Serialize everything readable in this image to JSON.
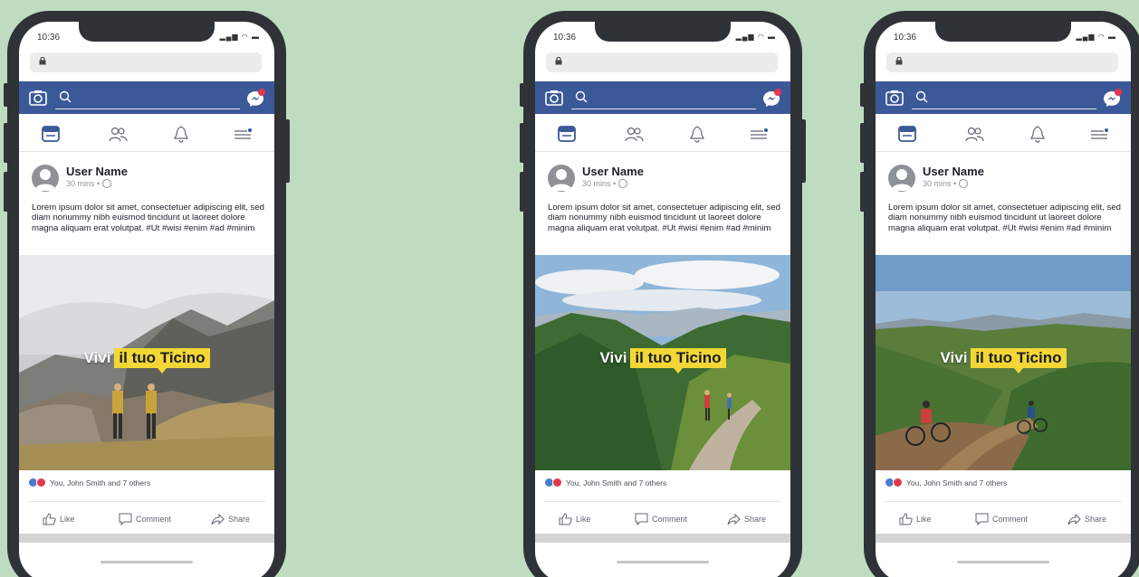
{
  "phones": [
    {
      "status": {
        "time": "10:36"
      },
      "post": {
        "user_name": "User Name",
        "meta": "30 mins •",
        "text": "Lorem ipsum dolor sit amet, consectetuer adipiscing elit, sed diam nonummy nibh euismod tincidunt ut laoreet dolore magna aliquam erat volutpat. #Ut #wisi #enim #ad #minim",
        "tagline_plain": "Vivi",
        "tagline_highlight": "il tuo Ticino",
        "reactions_text": "You, John Smith and 7 others"
      },
      "actions": {
        "like": "Like",
        "comment": "Comment",
        "share": "Share"
      }
    },
    {
      "status": {
        "time": "10:36"
      },
      "post": {
        "user_name": "User Name",
        "meta": "30 mins •",
        "text": "Lorem ipsum dolor sit amet, consectetuer adipiscing elit, sed diam nonummy nibh euismod tincidunt ut laoreet dolore magna aliquam erat volutpat. #Ut #wisi #enim #ad #minim",
        "tagline_plain": "Vivi",
        "tagline_highlight": "il tuo Ticino",
        "reactions_text": "You, John Smith and 7 others"
      },
      "actions": {
        "like": "Like",
        "comment": "Comment",
        "share": "Share"
      }
    },
    {
      "status": {
        "time": "10:36"
      },
      "post": {
        "user_name": "User Name",
        "meta": "30 mins •",
        "text": "Lorem ipsum dolor sit amet, consectetuer adipiscing elit, sed diam nonummy nibh euismod tincidunt ut laoreet dolore magna aliquam erat volutpat. #Ut #wisi #enim #ad #minim",
        "tagline_plain": "Vivi",
        "tagline_highlight": "il tuo Ticino",
        "reactions_text": "You, John Smith and 7 others"
      },
      "actions": {
        "like": "Like",
        "comment": "Comment",
        "share": "Share"
      }
    }
  ],
  "colors": {
    "background": "#bfdcc0",
    "phone_frame": "#2f3338",
    "facebook_blue": "#3b5998",
    "tagline_highlight": "#f2d737",
    "like_blue": "#4a7bd0",
    "love_red": "#e0394b"
  },
  "icons": [
    "lock-icon",
    "camera-icon",
    "search-icon",
    "messenger-icon",
    "news-feed-icon",
    "friends-icon",
    "notifications-icon",
    "menu-icon",
    "globe-icon",
    "like-icon",
    "comment-icon",
    "share-icon"
  ]
}
